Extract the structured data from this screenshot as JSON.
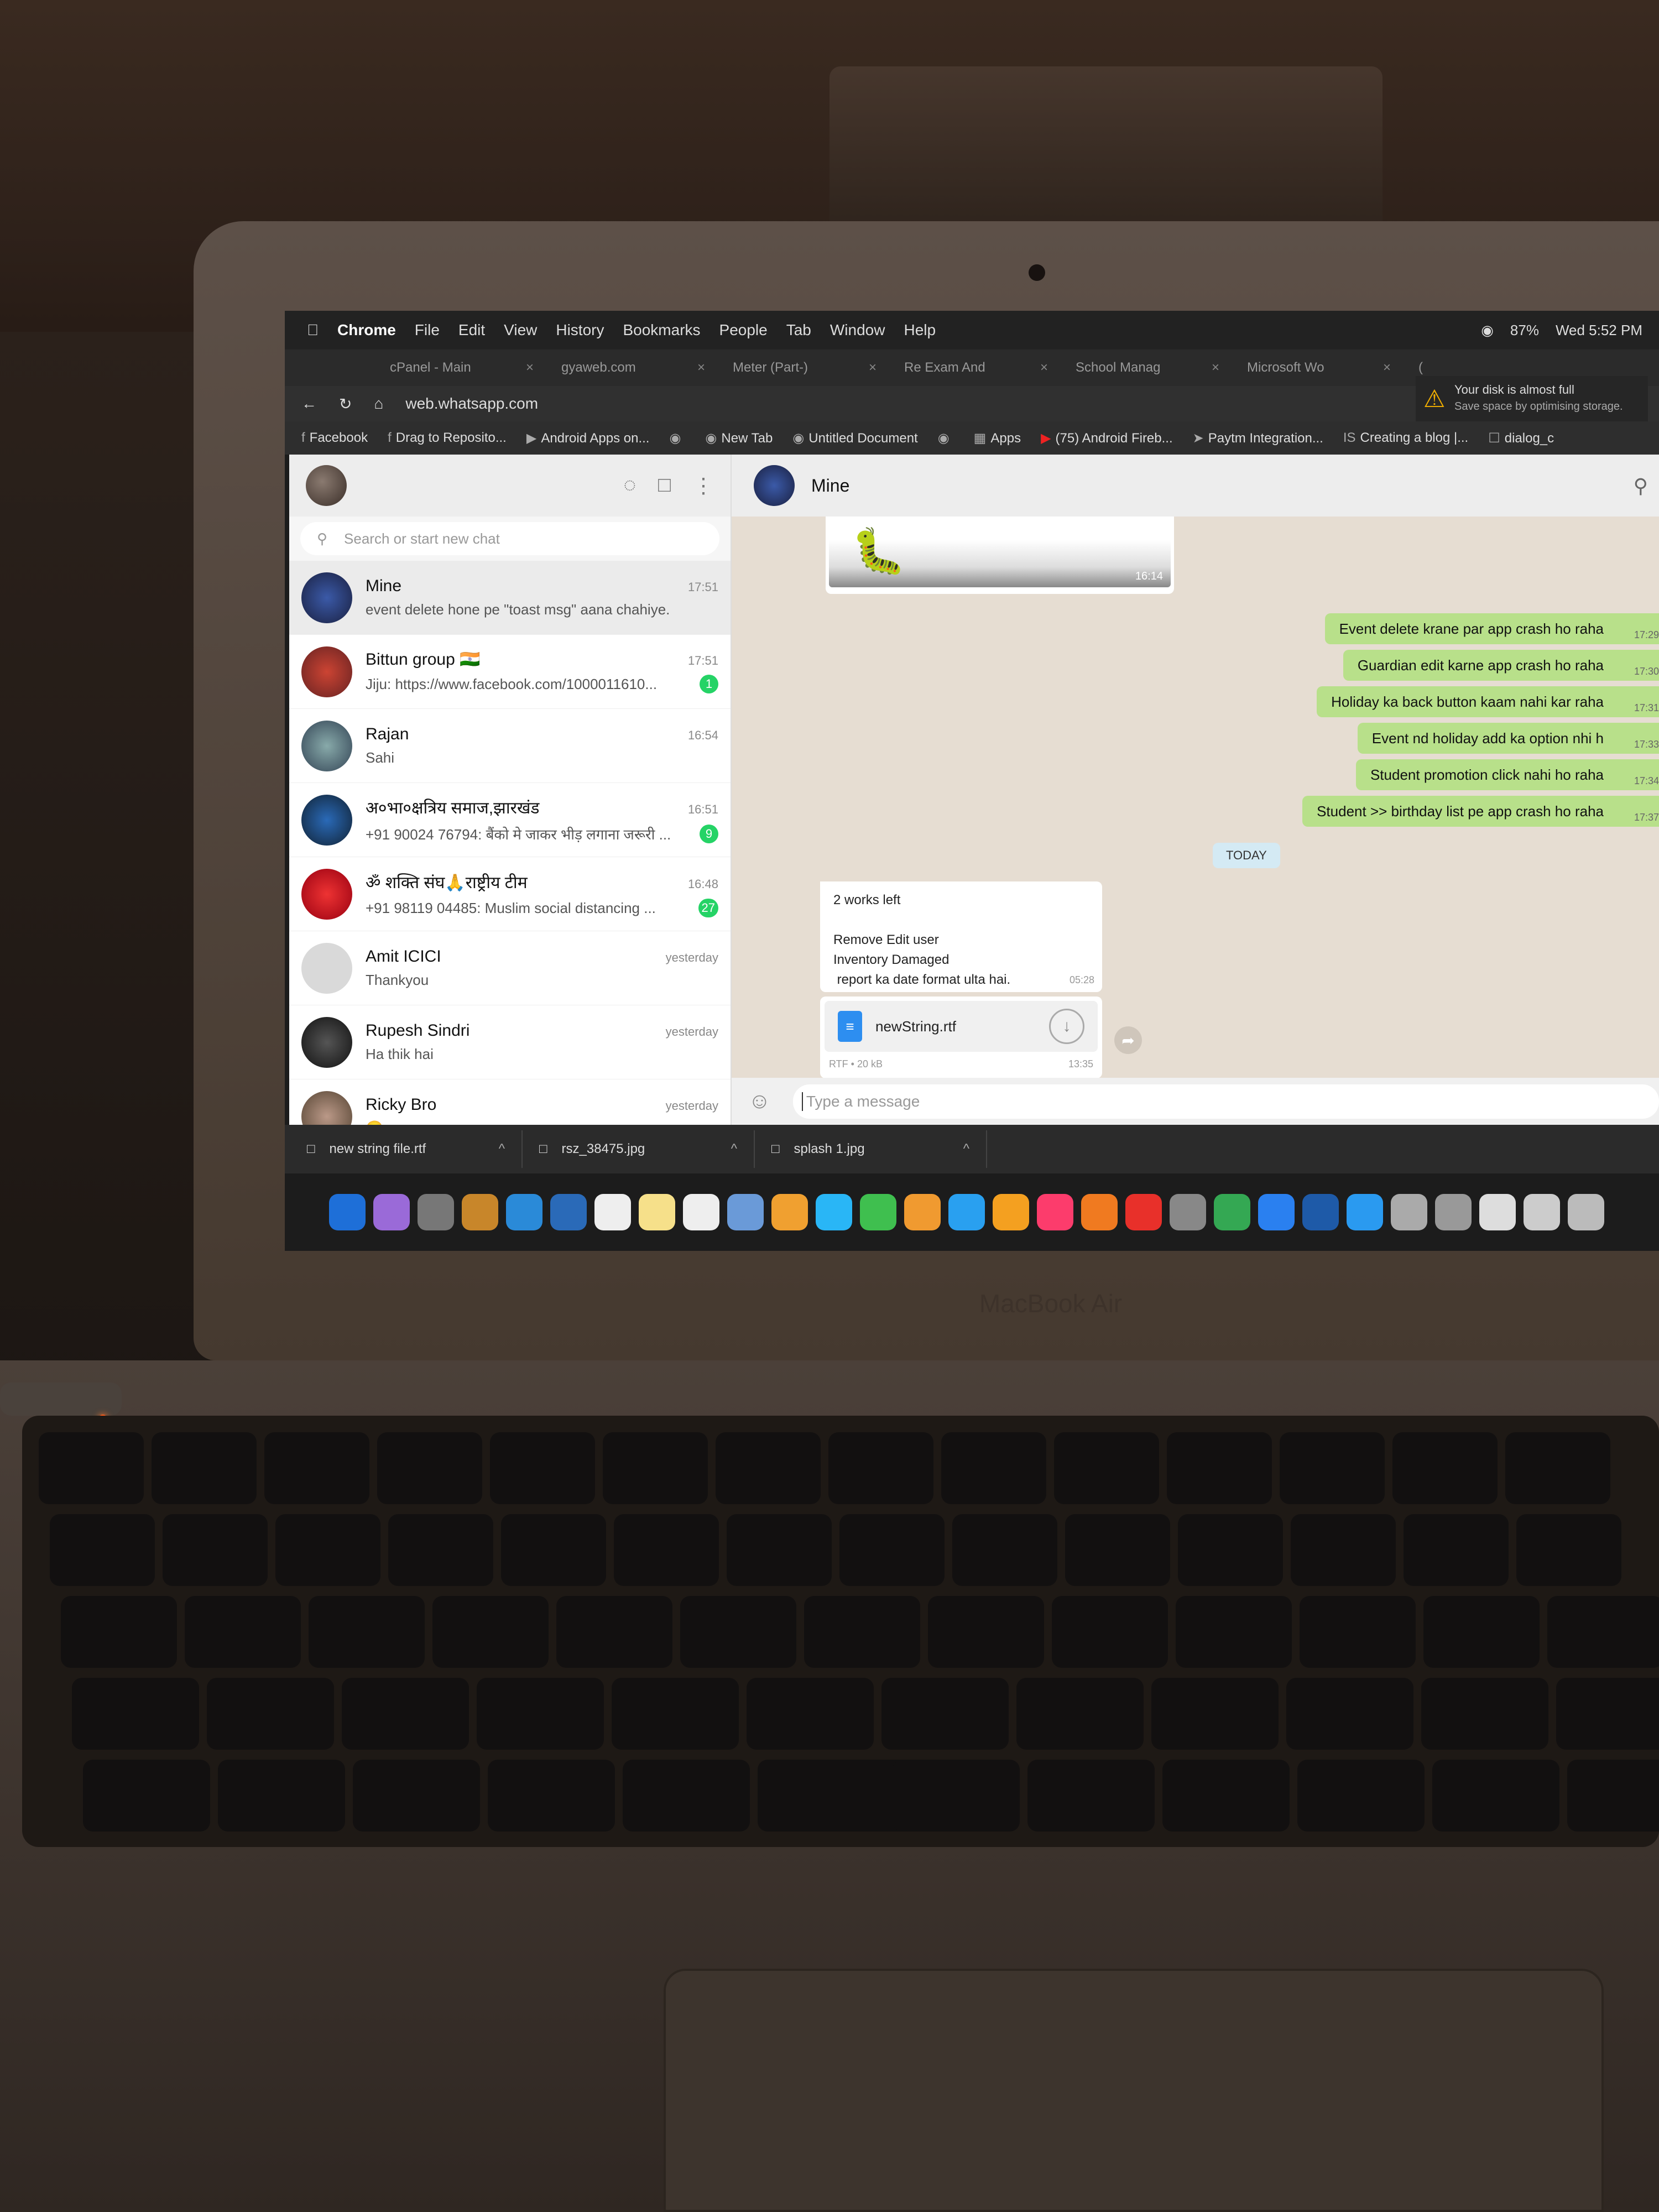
{
  "menubar": {
    "app": "Chrome",
    "items": [
      "File",
      "Edit",
      "View",
      "History",
      "Bookmarks",
      "People",
      "Tab",
      "Window",
      "Help"
    ],
    "battery": "87%",
    "clock": "Wed 5:52 PM"
  },
  "tabs": [
    "cPanel - Main",
    "gyaweb.com",
    "Meter (Part-)",
    "Re Exam And",
    "School Manag",
    "Microsoft Wo",
    "("
  ],
  "address": {
    "url": "web.whatsapp.com"
  },
  "disk_notice": {
    "title": "Your disk is almost full",
    "subtitle": "Save space by optimising storage."
  },
  "bookmarks": [
    "Facebook",
    "Drag to Reposito...",
    "Android Apps on...",
    "New Tab",
    "Untitled Document",
    "Apps",
    "(75) Android Fireb...",
    "Paytm Integration...",
    "Creating a blog |...",
    "dialog_c"
  ],
  "sidebar": {
    "search_placeholder": "Search or start new chat",
    "chats": [
      {
        "name": "Mine",
        "time": "17:51",
        "message": "event delete hone pe \"toast msg\" aana chahiye.",
        "badge": ""
      },
      {
        "name": "Bittun group 🇮🇳",
        "time": "17:51",
        "message": "Jiju: https://www.facebook.com/1000011610...",
        "badge": "1"
      },
      {
        "name": "Rajan",
        "time": "16:54",
        "message": "Sahi",
        "badge": ""
      },
      {
        "name": "अ०भा०क्षत्रिय समाज,झारखंड",
        "time": "16:51",
        "message": "+91 90024 76794: बैंको मे जाकर भीड़ लगाना जरूरी ...",
        "badge": "9"
      },
      {
        "name": "ॐ शक्ति संघ🙏राष्ट्रीय टीम",
        "time": "16:48",
        "message": "+91 98119 04485: Muslim social distancing ...",
        "badge": "27"
      },
      {
        "name": "Amit ICICI",
        "time": "yesterday",
        "message": "Thankyou",
        "badge": ""
      },
      {
        "name": "Rupesh Sindri",
        "time": "yesterday",
        "message": "Ha thik hai",
        "badge": ""
      },
      {
        "name": "Ricky Bro",
        "time": "yesterday",
        "message": "😊",
        "badge": ""
      }
    ]
  },
  "conversation": {
    "name": "Mine",
    "image_time": "16:14",
    "outgoing": [
      {
        "text": "Event delete krane par app crash ho raha",
        "time": "17:29"
      },
      {
        "text": "Guardian edit karne app crash ho raha",
        "time": "17:30"
      },
      {
        "text": "Holiday ka back button kaam nahi kar raha",
        "time": "17:31"
      },
      {
        "text": "Event nd holiday add ka option nhi h",
        "time": "17:33"
      },
      {
        "text": "Student promotion click nahi ho raha",
        "time": "17:34"
      },
      {
        "text": "Student >> birthday list pe app crash ho raha",
        "time": "17:37"
      }
    ],
    "date_divider": "TODAY",
    "incoming": {
      "lines": [
        "2 works left",
        "",
        "Remove Edit user",
        "Inventory Damaged",
        " report ka date format ulta hai."
      ],
      "time": "05:28"
    },
    "file": {
      "name": "newString.rtf",
      "meta": "RTF • 20 kB",
      "time": "13:35"
    },
    "composer_placeholder": "Type a message"
  },
  "downloads": [
    "new string file.rtf",
    "rsz_38475.jpg",
    "splash 1.jpg"
  ],
  "hardware": {
    "brand": "MacBook Air"
  },
  "dock_colors": [
    "#1e6fd8",
    "#9a6ad8",
    "#777",
    "#c8862a",
    "#2a8ad8",
    "#2a6ab8",
    "#eee",
    "#f6e08a",
    "#eee",
    "#6a9ad8",
    "#f0a030",
    "#29b6f6",
    "#3fbf4f",
    "#f09a30",
    "#29a0f0",
    "#f4a020",
    "#fc3c6c",
    "#f07a20",
    "#e8302a",
    "#888",
    "#34a853",
    "#2a80f0",
    "#1e5aa8",
    "#2a9af0",
    "#aaa",
    "#999",
    "#ddd",
    "#ccc",
    "#bbb"
  ]
}
